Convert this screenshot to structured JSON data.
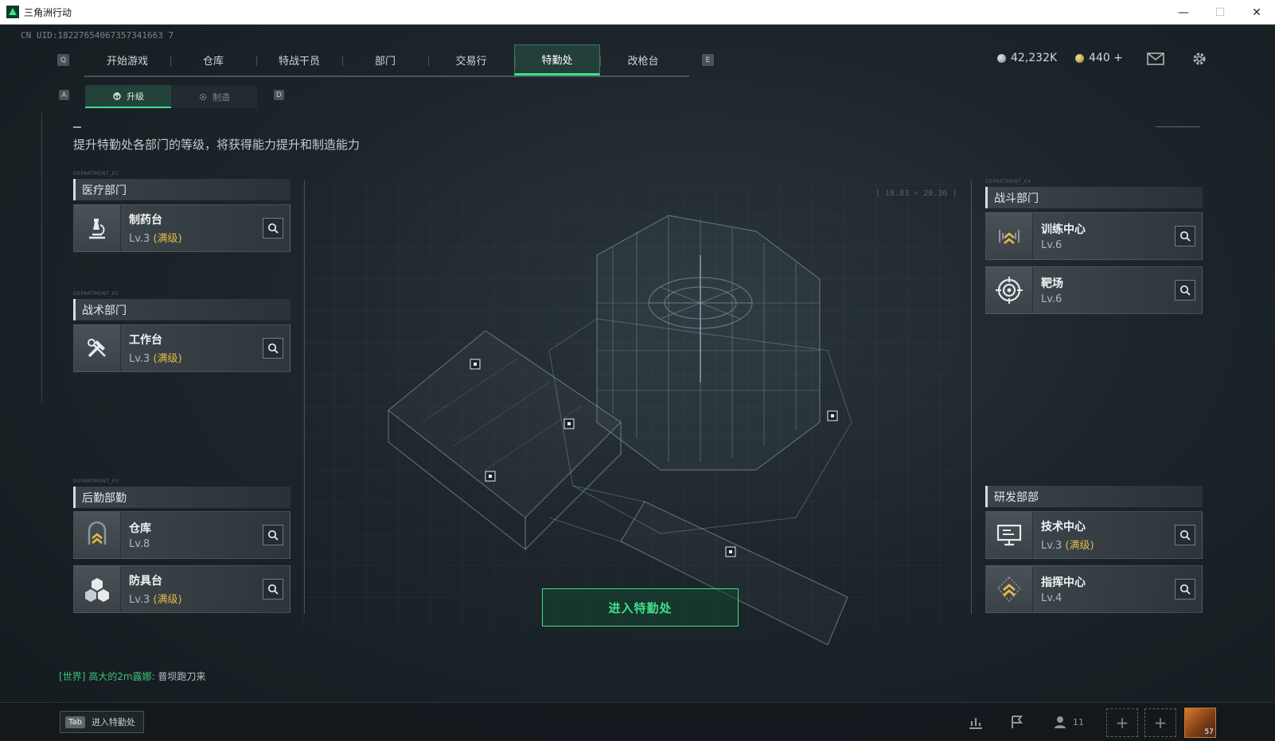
{
  "window": {
    "title": "三角洲行动",
    "minimize": "—",
    "maximize": "☐",
    "close": "✕"
  },
  "uid": "CN UID:18227654067357341663 7",
  "nav": {
    "left_key": "Q",
    "right_key": "E",
    "items": [
      {
        "label": "开始游戏",
        "active": false
      },
      {
        "label": "仓库",
        "active": false
      },
      {
        "label": "特战干员",
        "active": false
      },
      {
        "label": "部门",
        "active": false
      },
      {
        "label": "交易行",
        "active": false
      },
      {
        "label": "特勤处",
        "active": true
      },
      {
        "label": "改枪台",
        "active": false
      }
    ]
  },
  "subnav": {
    "left_key": "A",
    "right_key": "D",
    "upgrade": "升级",
    "craft": "制造"
  },
  "currency": {
    "silver": "42,232K",
    "gold": "440 +"
  },
  "description": "提升特勤处各部门的等级，将获得能力提升和制造能力",
  "departments": {
    "medical": {
      "tag": "DEPARTMENT_01",
      "title": "医疗部门",
      "cards": [
        {
          "name": "制药台",
          "level": "Lv.3",
          "max": "(满级)"
        }
      ]
    },
    "tactical": {
      "tag": "DEPARTMENT_02",
      "title": "战术部门",
      "cards": [
        {
          "name": "工作台",
          "level": "Lv.3",
          "max": "(满级)"
        }
      ]
    },
    "logistics": {
      "tag": "DEPARTMENT_03",
      "title": "后勤部勤",
      "cards": [
        {
          "name": "仓库",
          "level": "Lv.8",
          "max": ""
        },
        {
          "name": "防具台",
          "level": "Lv.3",
          "max": "(满级)"
        }
      ]
    },
    "combat": {
      "tag": "DEPARTMENT_04",
      "title": "战斗部门",
      "cards": [
        {
          "name": "训练中心",
          "level": "Lv.6",
          "max": ""
        },
        {
          "name": "靶场",
          "level": "Lv.6",
          "max": ""
        }
      ]
    },
    "research": {
      "title": "研发部部",
      "cards": [
        {
          "name": "技术中心",
          "level": "Lv.3",
          "max": "(满级)"
        },
        {
          "name": "指挥中心",
          "level": "Lv.4",
          "max": ""
        }
      ]
    }
  },
  "coordinates": "[ 18.83 ∘ 20.36 ]",
  "enter_button": "进入特勤处",
  "chat": {
    "channel": "[世界]",
    "name": "高大的2m露娜:",
    "message": "普坝跑刀来"
  },
  "bottom": {
    "tab_key": "Tab",
    "tab_label": "进入特勤处",
    "friends_count": "11"
  },
  "colors": {
    "accent": "#3fe08d",
    "max_level": "#e2b94b"
  }
}
